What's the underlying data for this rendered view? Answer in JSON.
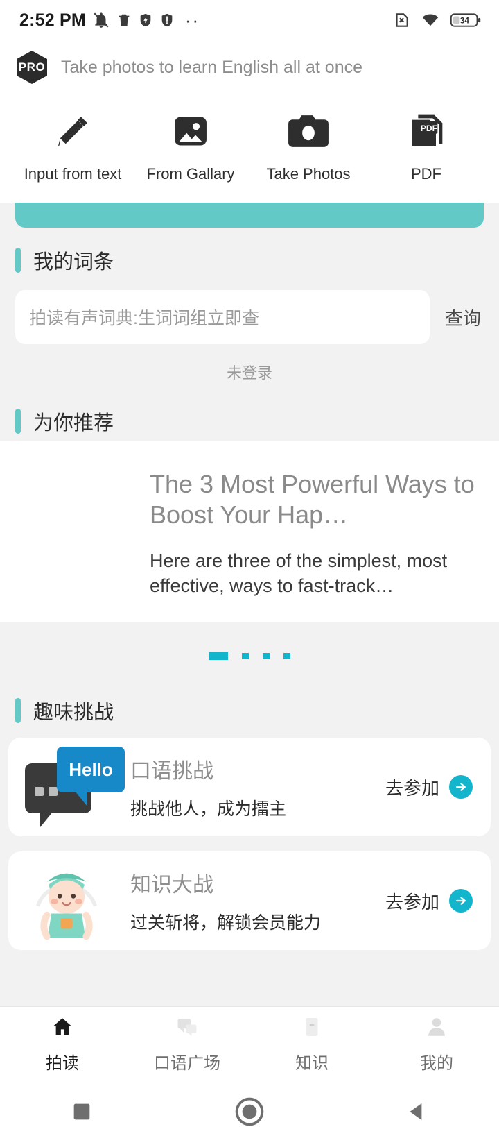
{
  "statusbar": {
    "time": "2:52 PM",
    "left_icons": [
      "bell-muted-icon",
      "trash-icon",
      "shield-flash-icon",
      "shield-alert-icon",
      "more-dots-icon"
    ],
    "right_icons": [
      "no-sim-icon",
      "wifi-icon",
      "battery-icon"
    ],
    "battery_level": "34"
  },
  "pro_header": {
    "badge": "PRO",
    "text": "Take photos to learn English all at once"
  },
  "actions": [
    {
      "label": "Input from text",
      "icon": "pencil-icon"
    },
    {
      "label": "From Gallary",
      "icon": "image-icon"
    },
    {
      "label": "Take Photos",
      "icon": "camera-icon"
    },
    {
      "label": "PDF",
      "icon": "pdf-icon"
    }
  ],
  "my_entries": {
    "section_title": "我的词条",
    "search_placeholder": "拍读有声词典:生词词组立即查",
    "search_value": "",
    "query_button": "查询",
    "login_state": "未登录"
  },
  "recommend": {
    "section_title": "为你推荐",
    "card_title": "The 3 Most Powerful Ways to Boost Your Hap…",
    "card_desc": "Here are three of the simplest, most effective, ways to fast-track…",
    "dots_total": 4,
    "dots_active_index": 0
  },
  "challenges": {
    "section_title": "趣味挑战",
    "items": [
      {
        "title": "口语挑战",
        "subtitle": "挑战他人，成为擂主",
        "cta": "去参加",
        "icon": "speech-bubble-hello-icon",
        "bubble_text": "Hello"
      },
      {
        "title": "知识大战",
        "subtitle": "过关斩将，解锁会员能力",
        "cta": "去参加",
        "icon": "mascot-nurse-icon",
        "bubble_text": ""
      }
    ]
  },
  "bottom_nav": [
    {
      "label": "拍读",
      "icon": "home-icon",
      "active": true
    },
    {
      "label": "口语广场",
      "icon": "chat-icon",
      "active": false
    },
    {
      "label": "知识",
      "icon": "book-icon",
      "active": false
    },
    {
      "label": "我的",
      "icon": "person-icon",
      "active": false
    }
  ],
  "system_nav": [
    {
      "icon": "square-recents-icon"
    },
    {
      "icon": "circle-home-icon"
    },
    {
      "icon": "triangle-back-icon"
    }
  ],
  "colors": {
    "accent_teal": "#63c9c6",
    "accent_cyan": "#12b5cb",
    "page_bg": "#f2f2f2",
    "card_bg": "#ffffff"
  }
}
